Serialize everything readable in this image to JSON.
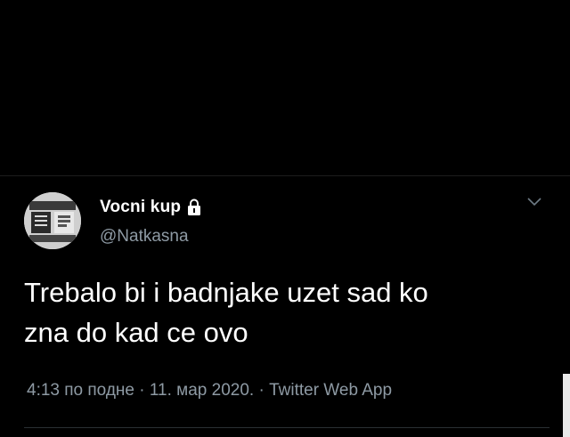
{
  "tweet": {
    "display_name": "Vocni kup",
    "handle": "@Natkasna",
    "text_line1": "Trebalo bi i badnjake uzet sad ko",
    "text_line2": "zna do kad ce ovo",
    "time": "4:13 по подне",
    "separator1": " · ",
    "date": "11. мар 2020.",
    "separator2": " · ",
    "source": "Twitter Web App"
  },
  "icons": {
    "protected": "lock-icon",
    "menu": "chevron-down-icon",
    "avatar": "avatar-image"
  },
  "colors": {
    "background": "#000000",
    "text": "#ffffff",
    "secondary": "#8e9aa4"
  }
}
